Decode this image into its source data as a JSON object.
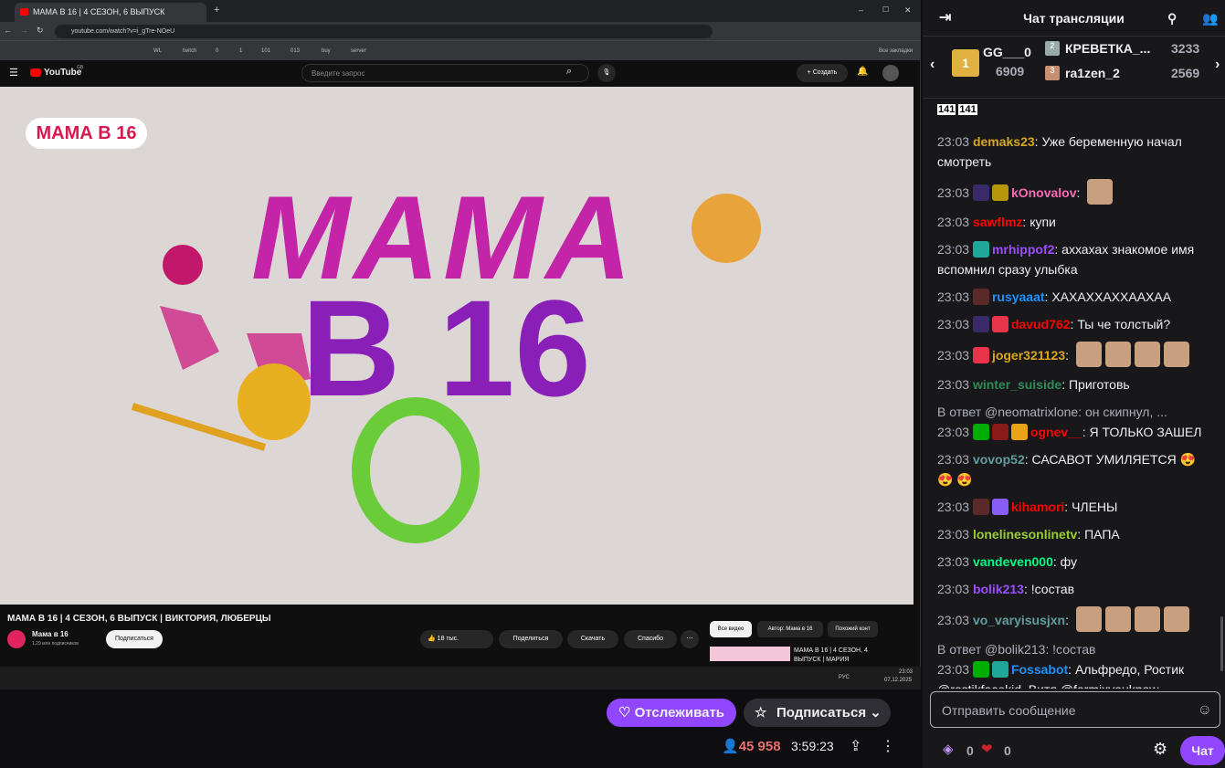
{
  "browser": {
    "tab_title": "МАМА В 16 | 4 СЕЗОН, 6 ВЫПУСК",
    "url": "youtube.com/watch?v=i_gTre-NOeU",
    "bookmarks": [
      "WL",
      "twitch",
      "0",
      "1",
      "101",
      "013",
      "buy",
      "server"
    ],
    "all_bookmarks": "Все закладки"
  },
  "youtube": {
    "logo": "YouTube",
    "region": "GB",
    "search_placeholder": "Введите запрос",
    "create_label": "Создать",
    "video_logo_badge": "МАМА В 16",
    "video_art_title": "МАМА",
    "video_art_number": "В 16",
    "video_title": "МАМА В 16 | 4 СЕЗОН, 6 ВЫПУСК | ВИКТОРИЯ, ЛЮБЕРЦЫ",
    "channel_name": "Мама в 16",
    "subscribers": "1,29 млн подписчиков",
    "subscribe": "Подписаться",
    "likes": "18 тыс.",
    "share": "Поделиться",
    "download": "Скачать",
    "thanks": "Спасибо",
    "chips": [
      "Все видео",
      "Автор: Мама в 16",
      "Похожий конт"
    ],
    "rec_title": "МАМА В 16 | 4 СЕЗОН, 4 ВЫПУСК | МАРИЯ"
  },
  "taskbar": {
    "lang": "РУС",
    "time": "23:03",
    "date": "07.12.2025"
  },
  "stream": {
    "follow_label": "Отслеживать",
    "subscribe_label": "Подписаться",
    "viewers": "45 958",
    "uptime": "3:59:23",
    "viewer_color": "#eb6f6f",
    "accent": "#9147ff"
  },
  "chat": {
    "title": "Чат трансляции",
    "leaders": [
      {
        "rank": "1",
        "name": "GG___0",
        "count": "6909"
      },
      {
        "rank": "2",
        "name": "КРЕВЕТКА_...",
        "count": "3233"
      },
      {
        "rank": "3",
        "name": "ra1zen_2",
        "count": "2569"
      }
    ],
    "emote_text": "141",
    "messages": [
      {
        "time": "23:03",
        "user": "demaks23",
        "color": "#daa520",
        "text": "Уже беременную начал смотреть",
        "badges": [],
        "emotes": 0
      },
      {
        "time": "23:03",
        "user": "kOnovalov",
        "color": "#ff69b4",
        "text": "",
        "badges": [
          "#3a2a6a",
          "#b8960c"
        ],
        "emotes": 1
      },
      {
        "time": "23:03",
        "user": "sawflmz",
        "color": "#ff0000",
        "text": "купи",
        "badges": [],
        "emotes": 0
      },
      {
        "time": "23:03",
        "user": "mrhippof2",
        "color": "#9b4dff",
        "text": "аххахах знакомое имя вспомнил сразу улыбка",
        "badges": [
          "#1fa89a"
        ],
        "emotes": 0
      },
      {
        "time": "23:03",
        "user": "rusyaaat",
        "color": "#1e90ff",
        "text": "ХАХАХХАХХААХАА",
        "badges": [
          "#5a2a2a"
        ],
        "emotes": 0
      },
      {
        "time": "23:03",
        "user": "davud762",
        "color": "#ff0000",
        "text": "Ты че толстый?",
        "badges": [
          "#3a2a6a",
          "#e8334a"
        ],
        "emotes": 0
      },
      {
        "time": "23:03",
        "user": "joger321123",
        "color": "#daa520",
        "text": "",
        "badges": [
          "#e8334a"
        ],
        "emotes": 4
      },
      {
        "time": "23:03",
        "user": "winter_suiside",
        "color": "#2e8b57",
        "text": "Приготовь",
        "badges": [],
        "emotes": 0
      },
      {
        "reply": "В ответ @neomatrixlone: он скипнул, ...",
        "time": "23:03",
        "user": "ognev__",
        "color": "#ff0000",
        "text": "Я ТОЛЬКО ЗАШЕЛ",
        "badges": [
          "#00ad03",
          "#8a1a1a",
          "#e8a317"
        ],
        "emotes": 0
      },
      {
        "time": "23:03",
        "user": "vovop52",
        "color": "#5f9ea0",
        "text": "САСАВОТ УМИЛЯЕТСЯ 😍 😍 😍",
        "badges": [],
        "emotes": 0
      },
      {
        "time": "23:03",
        "user": "kihamori",
        "color": "#ff0000",
        "text": "ЧЛЕНЫ",
        "badges": [
          "#5a2a2a",
          "#8a5cf6"
        ],
        "emotes": 0
      },
      {
        "time": "23:03",
        "user": "lonelinesonlinetv",
        "color": "#9acd32",
        "text": "ПАПА",
        "badges": [],
        "emotes": 0
      },
      {
        "time": "23:03",
        "user": "vandeven000",
        "color": "#00ff7f",
        "text": "фу",
        "badges": [],
        "emotes": 0
      },
      {
        "time": "23:03",
        "user": "bolik213",
        "color": "#9b4dff",
        "text": "!состав",
        "badges": [],
        "emotes": 0
      },
      {
        "time": "23:03",
        "user": "vo_varyisusjxn",
        "color": "#5f9ea0",
        "text": "",
        "badges": [],
        "emotes": 4
      },
      {
        "reply": "В ответ @bolik213: !состав",
        "time": "23:03",
        "user": "Fossabot",
        "color": "#1e90ff",
        "text": "Альфредо, Ростик @rostikfacekid, Витя @formixyouknow",
        "badges": [
          "#00ad03",
          "#1fa89a"
        ],
        "emotes": 0
      }
    ],
    "input_placeholder": "Отправить сообщение",
    "points_a": "0",
    "points_b": "0",
    "chat_button": "Чат"
  }
}
